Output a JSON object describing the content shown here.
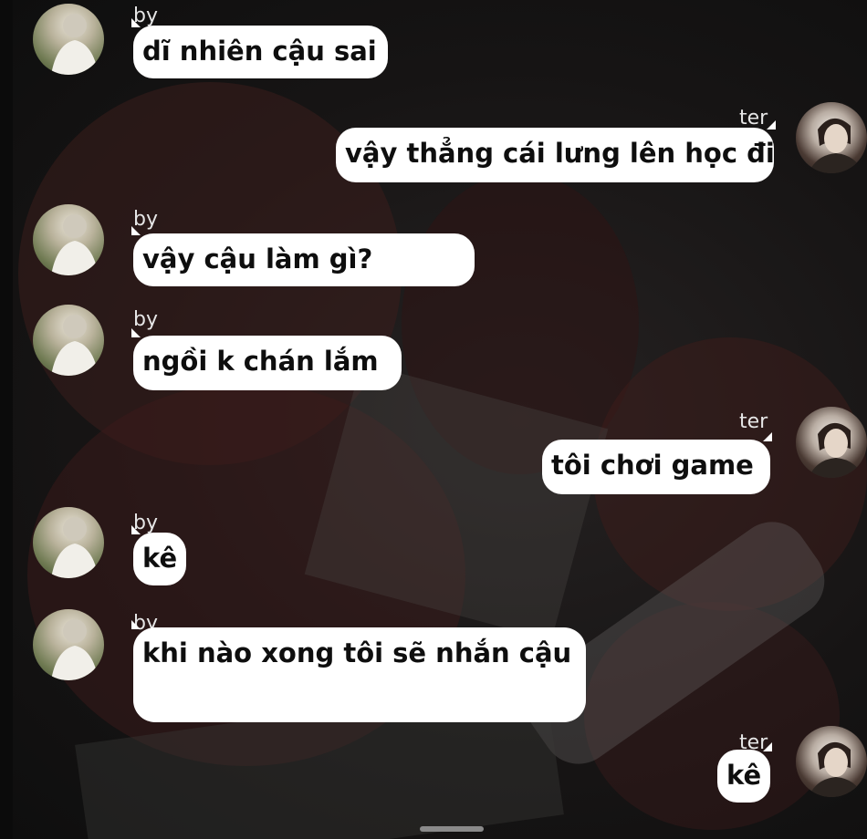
{
  "participants": {
    "by": {
      "name": "by",
      "avatar_icon": "profile-photo-by"
    },
    "ter": {
      "name": "ter",
      "avatar_icon": "profile-photo-ter"
    }
  },
  "messages": [
    {
      "sender": "by",
      "name": "by",
      "text": "dĩ nhiên cậu sai"
    },
    {
      "sender": "ter",
      "name": "ter",
      "text": "vậy thẳng cái lưng lên học đi"
    },
    {
      "sender": "by",
      "name": "by",
      "text": "vậy cậu làm gì?"
    },
    {
      "sender": "by",
      "name": "by",
      "text": "ngồi k chán lắm"
    },
    {
      "sender": "ter",
      "name": "ter",
      "text": "tôi chơi game"
    },
    {
      "sender": "by",
      "name": "by",
      "text": "kê"
    },
    {
      "sender": "by",
      "name": "by",
      "text": "khi nào xong tôi sẽ nhắn cậu"
    },
    {
      "sender": "ter",
      "name": "ter",
      "text": "kê"
    }
  ],
  "colors": {
    "bubble": "#ffffff",
    "text": "#0e0e0e",
    "name": "#e6e6e6",
    "background": "#141414"
  }
}
